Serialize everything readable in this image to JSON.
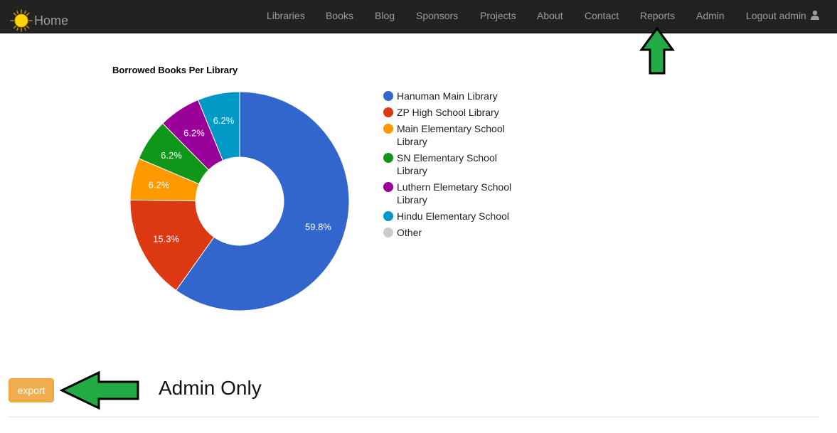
{
  "navbar": {
    "brand_label": "Home",
    "brand_icon": "sun-icon",
    "links": [
      "Libraries",
      "Books",
      "Blog",
      "Sponsors",
      "Projects",
      "About",
      "Contact",
      "Reports",
      "Admin"
    ],
    "logout_label": "Logout admin",
    "user_icon": "user-icon"
  },
  "chart_data": {
    "type": "pie",
    "title": "Borrowed Books Per Library",
    "categories": [
      "Hanuman Main Library",
      "ZP High School Library",
      "Main Elementary School Library",
      "SN Elementary School Library",
      "Luthern Elemetary School Library",
      "Hindu Elementary School",
      "Other"
    ],
    "values": [
      59.8,
      15.3,
      6.2,
      6.2,
      6.2,
      6.2,
      0
    ],
    "data_labels": [
      "59.8%",
      "15.3%",
      "6.2%",
      "6.2%",
      "6.2%",
      "6.2%",
      ""
    ],
    "colors": [
      "#3366cc",
      "#dc3912",
      "#ff9900",
      "#109618",
      "#990099",
      "#0099c6",
      "#cccccc"
    ],
    "legend_position": "right",
    "donut": true
  },
  "footer": {
    "export_label": "export",
    "annotation_text": "Admin Only"
  },
  "annotations": {
    "arrow_color": "#22aa44"
  }
}
